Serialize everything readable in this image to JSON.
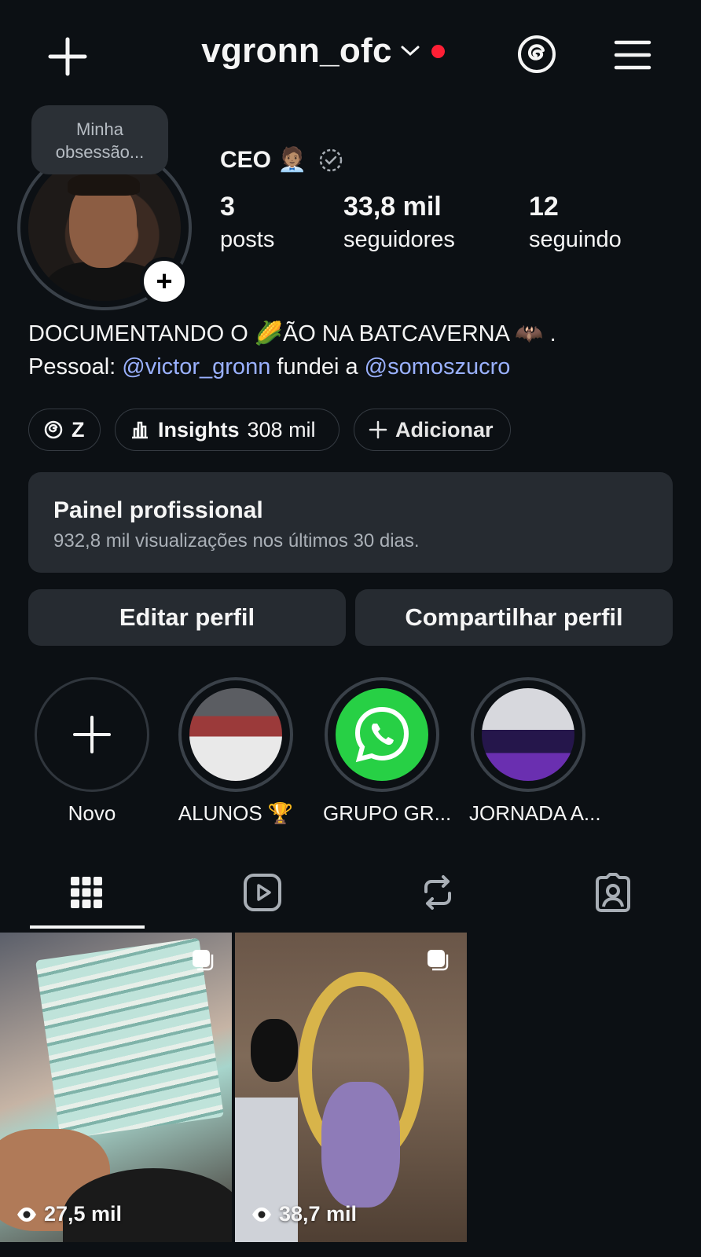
{
  "header": {
    "username": "vgronn_ofc",
    "notification_color": "#ff1f35"
  },
  "profile": {
    "note": "Minha obsessão...",
    "name": "CEO 🧑🏽‍💼",
    "stats": [
      {
        "value": "3",
        "label": "posts"
      },
      {
        "value": "33,8 mil",
        "label": "seguidores"
      },
      {
        "value": "12",
        "label": "seguindo"
      }
    ],
    "bio_line1": "DOCUMENTANDO O 🌽ÃO NA BATCAVERNA 🦇 .",
    "bio_line2_prefix": "Pessoal: ",
    "mention1": "@victor_gronn",
    "bio_line2_mid": " fundei a ",
    "mention2": "@somoszucro",
    "mention_color": "#9ab1ff"
  },
  "chips": {
    "threads_label": "Z",
    "insights_label": "Insights",
    "insights_value": "308 mil",
    "add_label": "Adicionar"
  },
  "pro_panel": {
    "title": "Painel profissional",
    "subtitle": "932,8 mil visualizações nos últimos 30 dias."
  },
  "buttons": {
    "edit": "Editar perfil",
    "share": "Compartilhar perfil"
  },
  "highlights": [
    {
      "label": "Novo",
      "icon": "plus-icon"
    },
    {
      "label": "ALUNOS 🏆"
    },
    {
      "label": "GRUPO GR...",
      "icon": "whatsapp-icon"
    },
    {
      "label": "JORNADA A..."
    }
  ],
  "tabs": [
    "grid-icon",
    "reels-icon",
    "reposts-icon",
    "tagged-icon"
  ],
  "posts": [
    {
      "views": "27,5 mil"
    },
    {
      "views": "38,7 mil"
    }
  ]
}
